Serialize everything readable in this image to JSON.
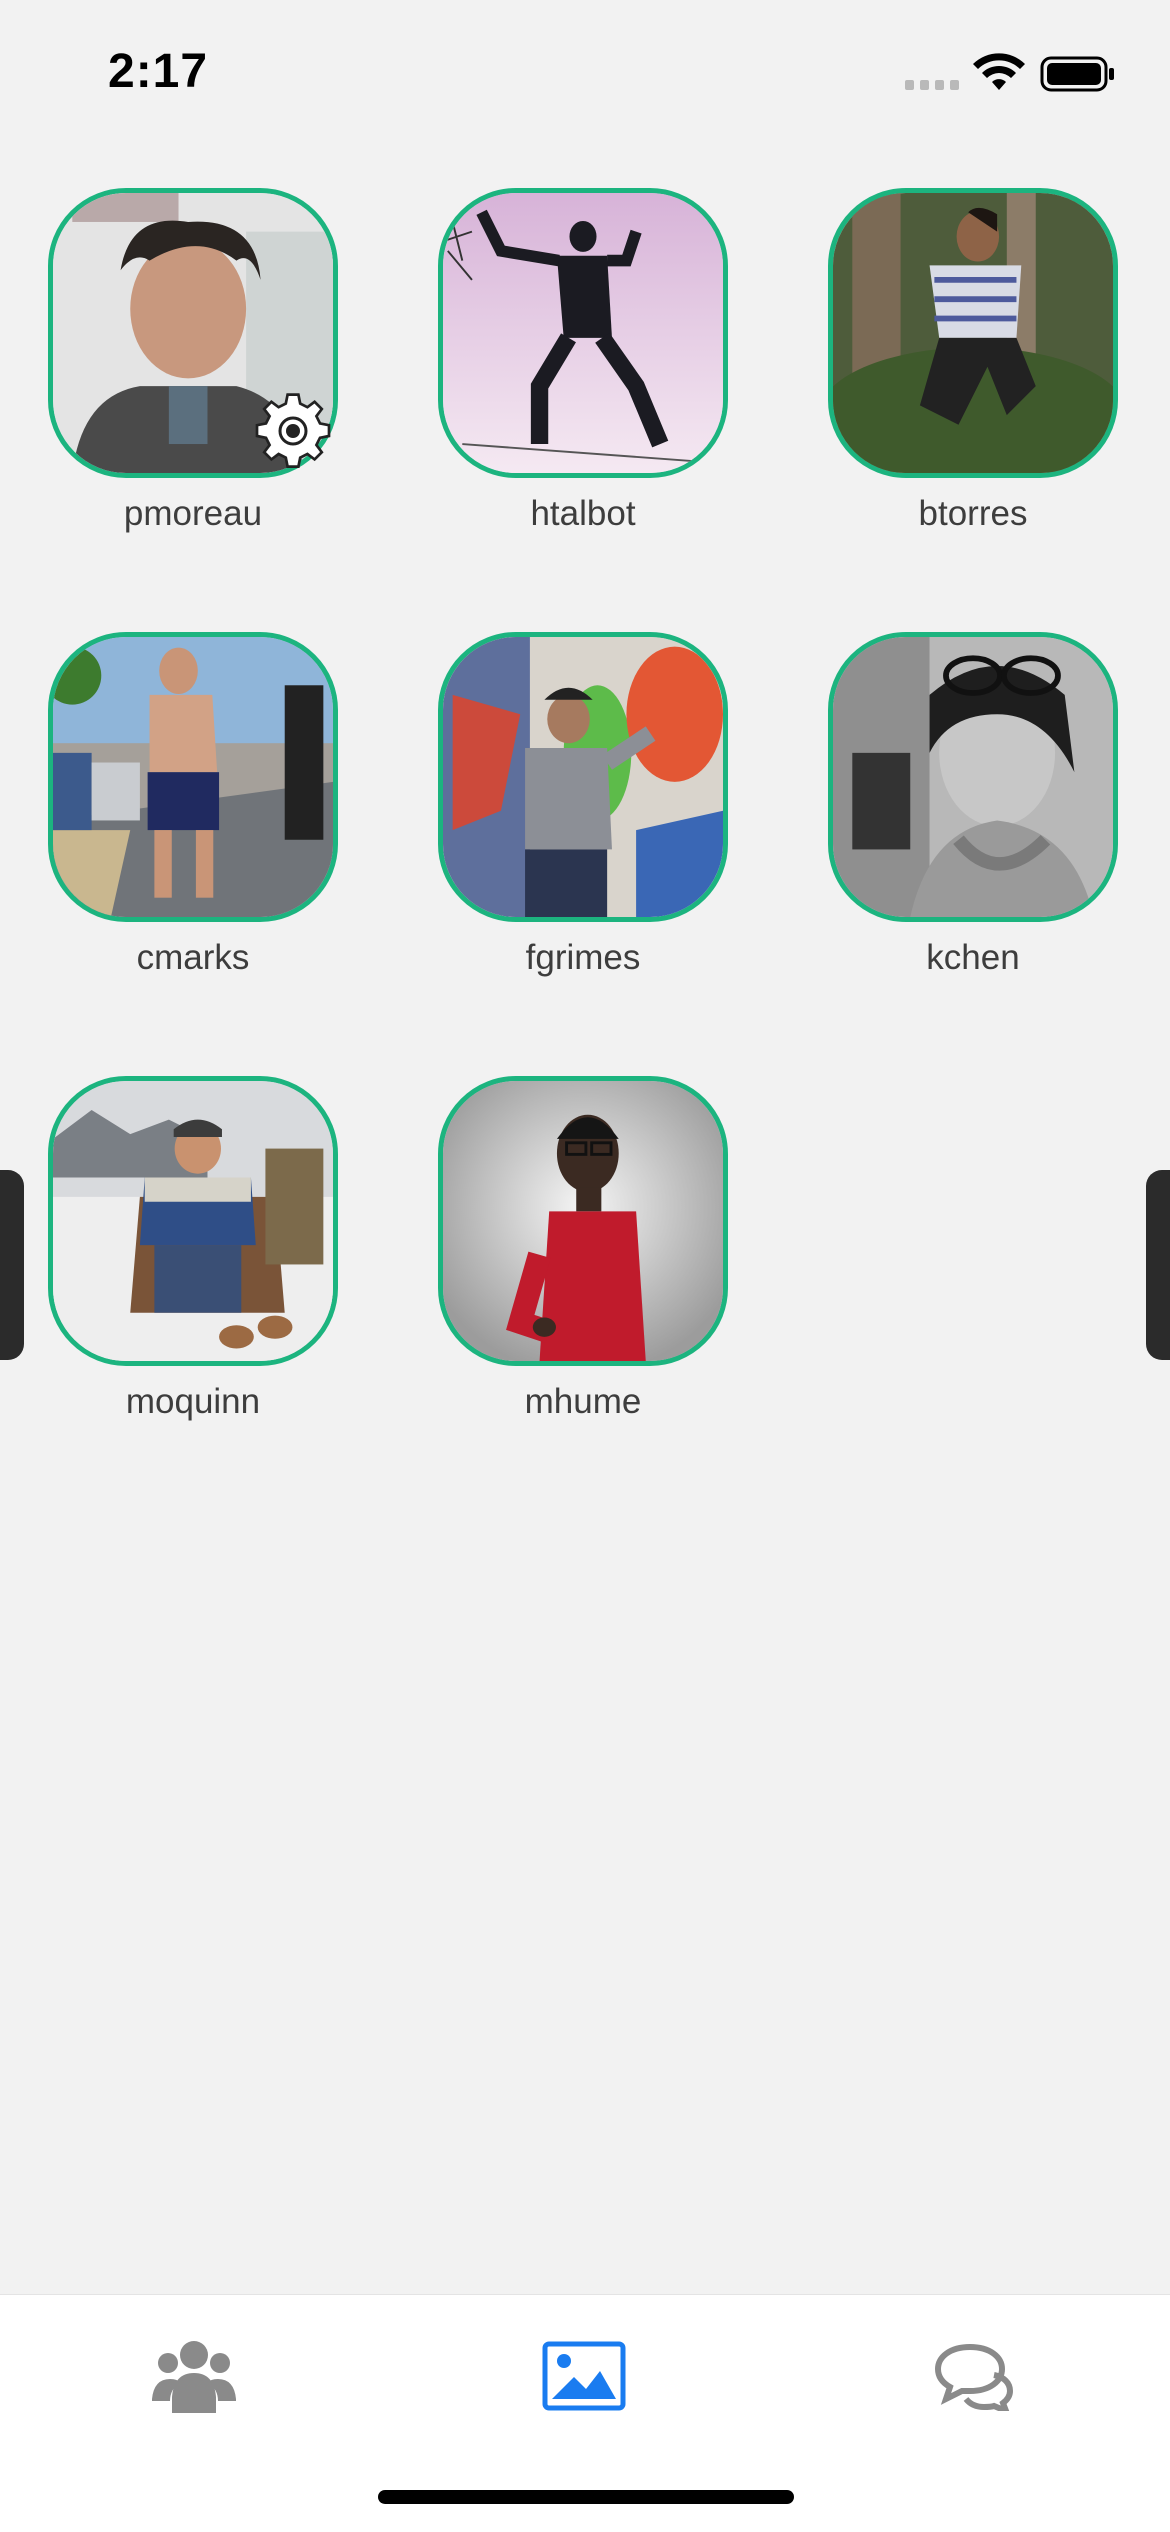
{
  "status_bar": {
    "time": "2:17",
    "signal_icon": "cellular-signal-icon",
    "wifi_icon": "wifi-icon",
    "battery_icon": "battery-full-icon"
  },
  "users": [
    {
      "username": "pmoreau",
      "is_self": true,
      "badge_icon": "gear-icon"
    },
    {
      "username": "htalbot"
    },
    {
      "username": "btorres"
    },
    {
      "username": "cmarks"
    },
    {
      "username": "fgrimes"
    },
    {
      "username": "kchen"
    },
    {
      "username": "moquinn"
    },
    {
      "username": "mhume"
    }
  ],
  "tab_bar": {
    "tabs": [
      {
        "name": "people",
        "icon": "people-group-icon",
        "active": false
      },
      {
        "name": "photos",
        "icon": "image-icon",
        "active": true
      },
      {
        "name": "chat",
        "icon": "chat-bubbles-icon",
        "active": false
      }
    ]
  },
  "colors": {
    "accent_border": "#1cb47f",
    "active_tab": "#1a7cf0",
    "inactive_tab": "#8a8a8a",
    "background": "#f2f2f2"
  }
}
